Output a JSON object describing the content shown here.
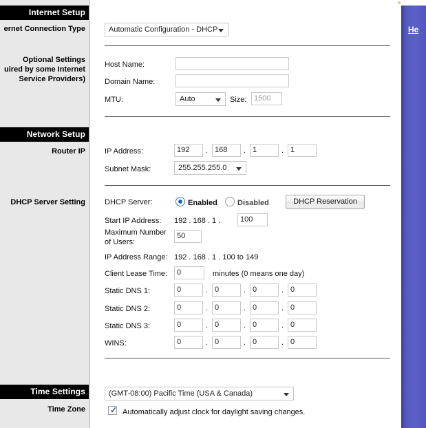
{
  "sidebar": {
    "sections": [
      {
        "header": "Internet Setup",
        "labels": [
          "ernet Connection Type"
        ]
      },
      {
        "header": "Network Setup",
        "labels": [
          "Router IP",
          "DHCP Server Setting"
        ]
      },
      {
        "header": "Time Settings",
        "labels": [
          "Time Zone"
        ]
      }
    ],
    "internet_setup_header": "Internet Setup",
    "internet_connection_type_label": "ernet Connection Type",
    "optional_settings_label_line1": "Optional Settings",
    "optional_settings_label_line2": "uired by some Internet",
    "optional_settings_label_line3": "Service Providers)",
    "network_setup_header": "Network Setup",
    "router_ip_label": "Router IP",
    "dhcp_server_setting_label": "DHCP Server Setting",
    "time_settings_header": "Time Settings",
    "time_zone_label": "Time Zone"
  },
  "internet_setup": {
    "connection_type_value": "Automatic Configuration - DHCP"
  },
  "optional_settings": {
    "host_name_label": "Host Name:",
    "host_name_value": "",
    "domain_name_label": "Domain Name:",
    "domain_name_value": "",
    "mtu_label": "MTU:",
    "mtu_value": "Auto",
    "size_label": "Size:",
    "size_value": "1500"
  },
  "router_ip": {
    "ip_address_label": "IP Address:",
    "ip_octets": [
      "192",
      "168",
      "1",
      "1"
    ],
    "subnet_mask_label": "Subnet Mask:",
    "subnet_mask_value": "255.255.255.0"
  },
  "dhcp": {
    "server_label": "DHCP Server:",
    "enabled_label": "Enabled",
    "disabled_label": "Disabled",
    "selected": "Enabled",
    "reservation_button": "DHCP Reservation",
    "start_ip_label": "Start IP Address:",
    "start_ip_prefix": "192 .  168 .  1 .",
    "start_ip_last_octet": "100",
    "max_users_label_line1": "Maximum Number",
    "max_users_label_line2": "of Users:",
    "max_users_value": "50",
    "ip_range_label": "IP Address Range:",
    "ip_range_value": "192 .  168 .  1 .  100 to 149",
    "lease_time_label": "Client Lease Time:",
    "lease_time_value": "0",
    "lease_time_suffix": "minutes (0 means one day)",
    "static_dns_1_label": "Static DNS 1:",
    "static_dns_1": [
      "0",
      "0",
      "0",
      "0"
    ],
    "static_dns_2_label": "Static DNS 2:",
    "static_dns_2": [
      "0",
      "0",
      "0",
      "0"
    ],
    "static_dns_3_label": "Static DNS 3:",
    "static_dns_3": [
      "0",
      "0",
      "0",
      "0"
    ],
    "wins_label": "WINS:",
    "wins": [
      "0",
      "0",
      "0",
      "0"
    ]
  },
  "time_settings": {
    "timezone_value": "(GMT-08:00) Pacific Time (USA & Canada)",
    "daylight_label": "Automatically adjust clock for daylight saving changes.",
    "daylight_checked": true
  },
  "help_panel": {
    "link_label": "He",
    "background_color": "#5559bf"
  },
  "separators": {
    "dot": "."
  }
}
